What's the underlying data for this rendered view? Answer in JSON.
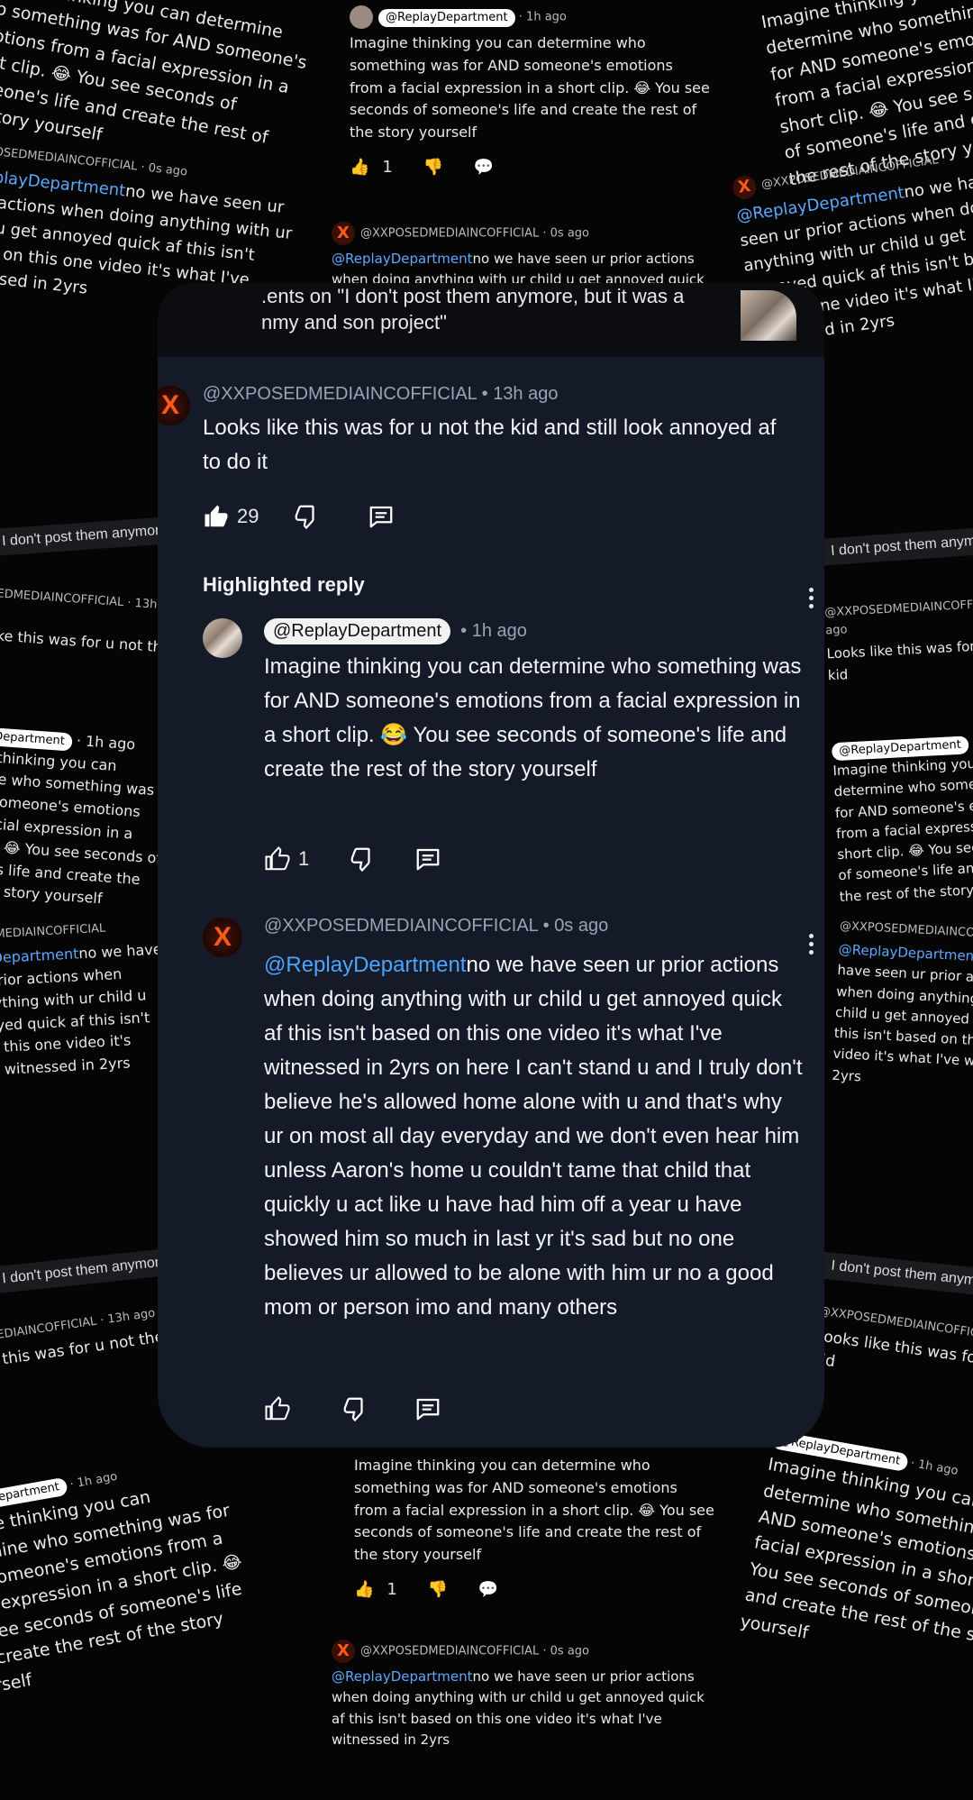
{
  "header": {
    "title_prefix": ".ents on \"I don't post them anymore, but it was a",
    "title_suffix": "nmy and son project\""
  },
  "comments": [
    {
      "author": "@XXPOSEDMEDIAINCOFFICIAL",
      "time": "13h ago",
      "text": "Looks like this was for u not the kid and still look annoyed af to do it",
      "likes": "29"
    }
  ],
  "highlighted_section_label": "Highlighted reply",
  "replies": [
    {
      "author": "@ReplayDepartment",
      "time": "1h ago",
      "text": "Imagine thinking you can determine who something was for AND someone's emotions from a facial expression in a short clip. 😂 You see seconds of someone's life and create the rest of the story yourself",
      "likes": "1"
    },
    {
      "author": "@XXPOSEDMEDIAINCOFFICIAL",
      "time": "0s ago",
      "mention": "@ReplayDepartment",
      "text": "no we have seen ur prior actions when doing anything with ur child u get annoyed quick af this isn't based on this one video it's what I've witnessed in 2yrs on here I can't stand u and I truly don't believe he's allowed home alone with u and that's why ur on most all day everyday and we don't even hear him unless Aaron's home u couldn't tame that child that quickly u act like u have had him off a year u have showed him so much in last yr it's sad but no one believes ur allowed to be alone with him ur no a good mom or person imo and many others",
      "likes": ""
    }
  ],
  "background": {
    "fragments": [
      "Imagine thinking you can determine who something was for AND someone's emotions from a facial expression in a short clip. 😂 You see seconds of someone's life and create the rest of the story yourself",
      "no we have seen ur prior actions when doing anything with ur child u get annoyed quick af this isn't based on this one video it's what I've witnessed in 2yrs",
      "Looks like this was for u not the kid",
      "I don't post them anymore, but",
      "Highlighted reply"
    ],
    "handles": [
      "@ReplayDepartment",
      "@XXPOSEDMEDIAINCOFFICIAL"
    ],
    "times": [
      "1h ago",
      "0s ago",
      "13h ago"
    ],
    "like_count": "1"
  },
  "colors": {
    "panel_bg": "#141a28",
    "mention": "#4ea3ff",
    "meta": "#9aa3b2",
    "avatar_accent": "#ff5a1a"
  },
  "icons": [
    "thumb-up-icon",
    "thumb-down-icon",
    "reply-icon",
    "more-vertical-icon"
  ]
}
